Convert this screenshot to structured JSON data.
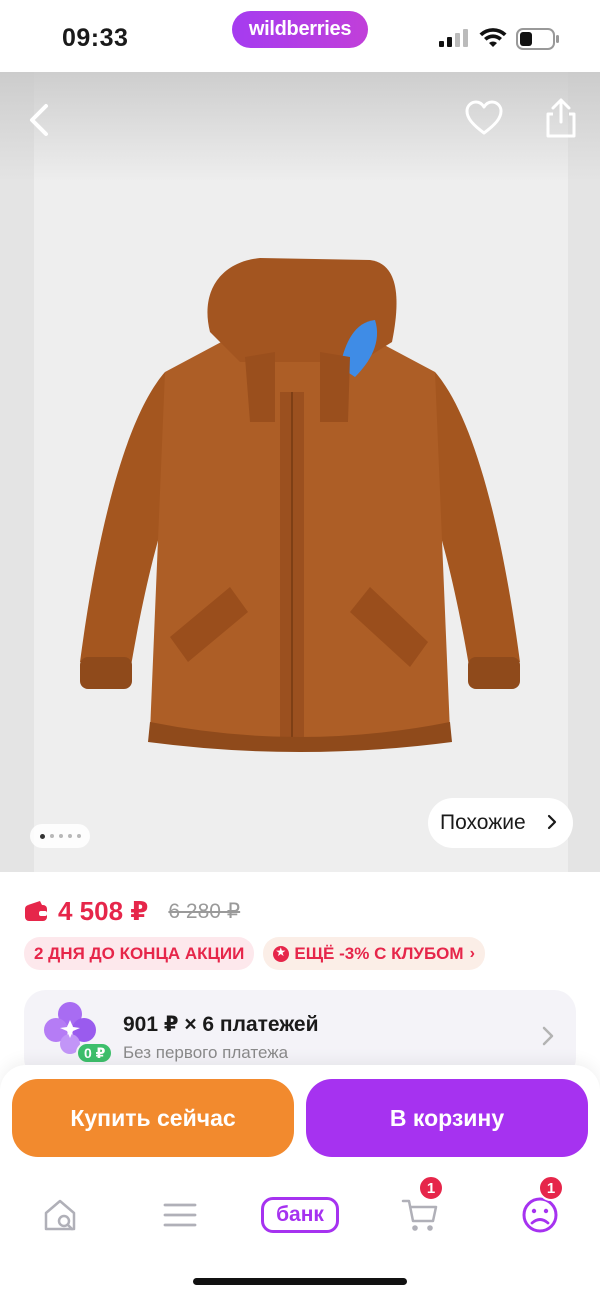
{
  "status_bar": {
    "time": "09:33",
    "app_logo": "wildberries",
    "icons": [
      "cellular-signal-icon",
      "wifi-icon",
      "battery-icon"
    ]
  },
  "gallery": {
    "similar_label": "Похожие",
    "page_count": 5,
    "active_page": 1,
    "icons": [
      "back-arrow-icon",
      "heart-icon",
      "share-icon"
    ]
  },
  "price": {
    "current": "4 508 ₽",
    "old": "6 280 ₽"
  },
  "badges": {
    "sale_label": "2 ДНЯ ДО КОНЦА АКЦИИ",
    "club_label": "ЕЩЁ -3% С КЛУБОМ"
  },
  "installment": {
    "title": "901 ₽ × 6 платежей",
    "subtitle": "Без первого платежа",
    "zero_badge": "0 ₽"
  },
  "actions": {
    "buy_now": "Купить сейчас",
    "add_to_cart": "В корзину"
  },
  "tabbar": {
    "bank_label": "банк",
    "cart_count": "1",
    "profile_count": "1"
  },
  "colors": {
    "brand_purple": "#a632f0",
    "buy_orange": "#f28a2e",
    "price_red": "#e6264a",
    "jacket_brown": "#a85a26"
  }
}
